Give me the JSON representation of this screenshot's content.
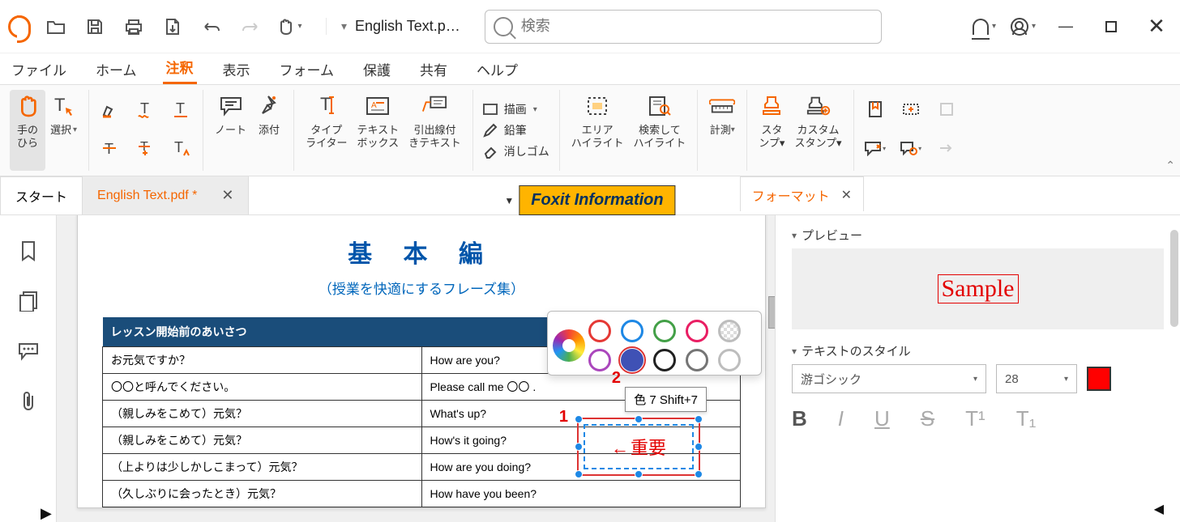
{
  "titlebar": {
    "filename": "English Text.p…",
    "search_placeholder": "検索"
  },
  "menu": {
    "items": [
      "ファイル",
      "ホーム",
      "注釈",
      "表示",
      "フォーム",
      "保護",
      "共有",
      "ヘルプ"
    ],
    "active_index": 2
  },
  "ribbon": {
    "hand": "手の\nひら",
    "select": "選択",
    "note": "ノート",
    "attach": "添付",
    "typewriter": "タイプ\nライター",
    "textbox": "テキスト\nボックス",
    "callout": "引出線付\nきテキスト",
    "draw_shape": "描画",
    "pencil": "鉛筆",
    "eraser": "消しゴム",
    "area_hl": "エリア\nハイライト",
    "search_hl": "検索して\nハイライト",
    "measure": "計測",
    "stamp": "スタ\nンプ",
    "custom_stamp": "カスタム\nスタンプ"
  },
  "doctabs": {
    "start": "スタート",
    "file": "English Text.pdf *",
    "banner": "Foxit Information",
    "format": "フォーマット"
  },
  "document": {
    "title": "基 本 編",
    "subtitle": "（授業を快適にするフレーズ集）",
    "section_header": "レッスン開始前のあいさつ",
    "rows": [
      {
        "jp": "お元気ですか？",
        "en": "How are you?"
      },
      {
        "jp": "〇〇と呼んでください。",
        "en": "Please call me 〇〇 ."
      },
      {
        "jp": "（親しみをこめて）元気？",
        "en": "What's up?"
      },
      {
        "jp": "（親しみをこめて）元気？",
        "en": "How's it going?"
      },
      {
        "jp": "（上よりは少しかしこまって）元気？",
        "en": "How are you doing?"
      },
      {
        "jp": "（久しぶりに会ったとき）元気？",
        "en": "How have you been?"
      }
    ],
    "annotation_text": "重要",
    "tooltip": "色 7    Shift+7",
    "marker1": "1",
    "marker2": "2"
  },
  "color_popup": {
    "row1": [
      "#e53935",
      "#1e88e5",
      "#43a047",
      "#e91e63",
      "#bdbdbd"
    ],
    "row2": [
      "#ab47bc",
      "#3f51b5",
      "#212121",
      "#757575",
      "#e0e0e0"
    ],
    "selected": "#3f51b5"
  },
  "format_panel": {
    "preview": "プレビュー",
    "sample": "Sample",
    "text_style": "テキストのスタイル",
    "font": "游ゴシック",
    "size": "28",
    "color": "#ff0000",
    "buttons": {
      "bold": "B",
      "italic": "I",
      "underline": "U",
      "strike": "S",
      "sup": "T¹",
      "sub": "T₁"
    }
  }
}
